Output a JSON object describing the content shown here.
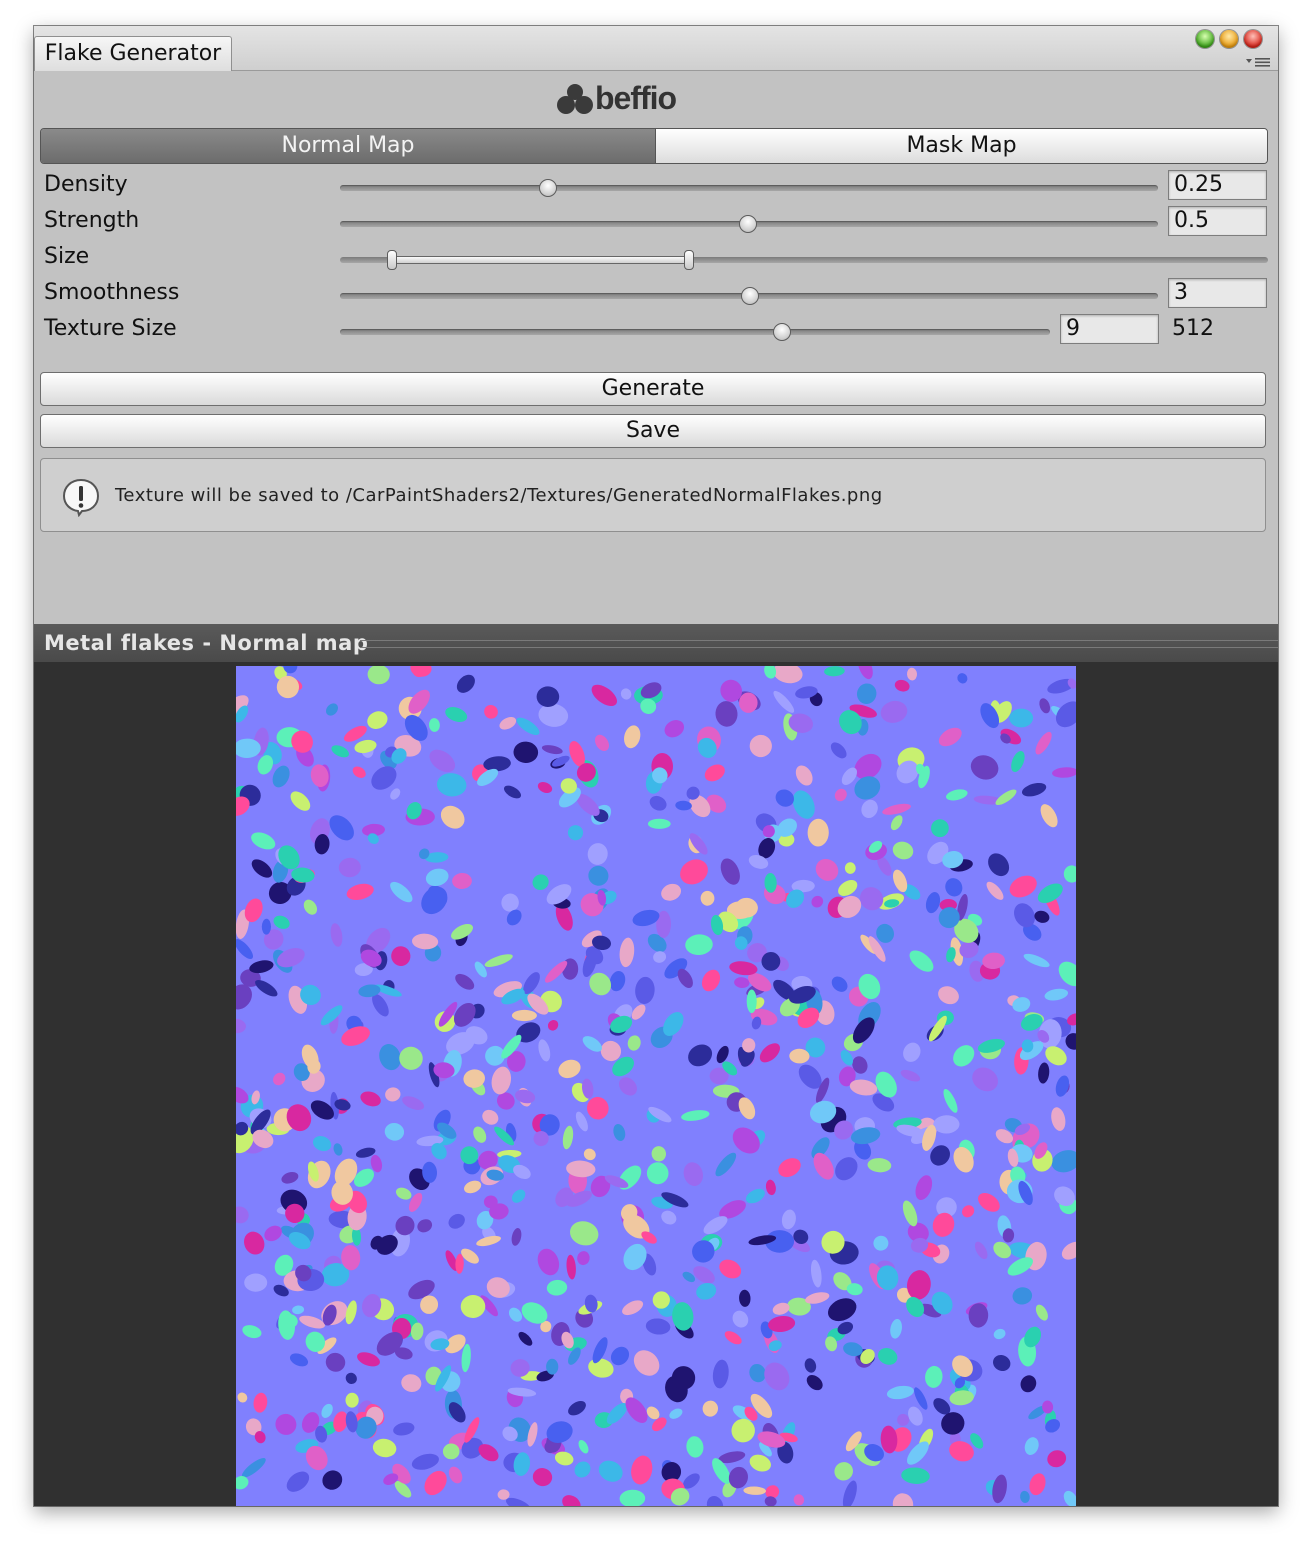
{
  "window": {
    "tab_title": "Flake Generator",
    "logo_text": "beffio"
  },
  "mode_tabs": [
    {
      "label": "Normal Map",
      "active": true
    },
    {
      "label": "Mask Map",
      "active": false
    }
  ],
  "params": {
    "density": {
      "label": "Density",
      "value": "0.25",
      "fraction": 0.25
    },
    "strength": {
      "label": "Strength",
      "value": "0.5",
      "fraction": 0.5
    },
    "size": {
      "label": "Size",
      "min_fraction": 0.057,
      "max_fraction": 0.378
    },
    "smoothness": {
      "label": "Smoothness",
      "value": "3",
      "fraction": 0.5
    },
    "texture_size": {
      "label": "Texture Size",
      "value": "9",
      "fraction": 0.6,
      "resolution": "512"
    }
  },
  "buttons": {
    "generate": "Generate",
    "save": "Save"
  },
  "help": {
    "message": "Texture will be saved to /CarPaintShaders2/Textures/GeneratedNormalFlakes.png"
  },
  "preview": {
    "title": "Metal flakes - Normal map",
    "background_color": "#8080fe",
    "flake_colors": [
      "#5a5ae6",
      "#2c2c9a",
      "#1f1470",
      "#3cb8e8",
      "#2ad0b0",
      "#5cf0b8",
      "#9ae88a",
      "#c8f070",
      "#e060c8",
      "#ff4a9a",
      "#d828a0",
      "#b048e0",
      "#9a6af0",
      "#e8a8c8",
      "#f0c8a0",
      "#70c8f8",
      "#4860f0",
      "#3a90e0",
      "#a0a0ff",
      "#6a40c0"
    ]
  }
}
